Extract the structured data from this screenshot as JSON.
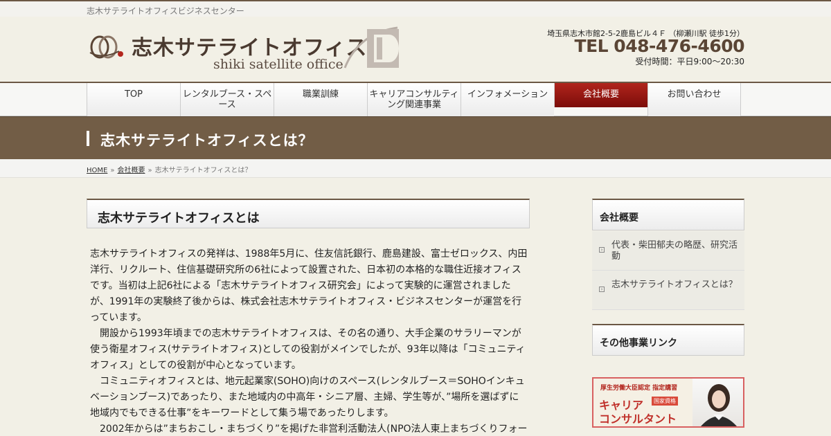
{
  "site": {
    "tagline": "志木サテライトオフィスビジネスセンター",
    "logo_main": "志木サテライトオフィス",
    "logo_sub": "shiki satellite office"
  },
  "contact": {
    "address": "埼玉県志木市館2-5-2鹿島ビル４Ｆ （柳瀬川駅 徒歩1分）",
    "tel": "TEL 048-476-4600",
    "hours": "受付時間：平日9:00～20:30"
  },
  "nav": {
    "items": [
      {
        "label": "TOP"
      },
      {
        "label": "レンタルブース・スペース"
      },
      {
        "label": "職業訓練"
      },
      {
        "label": "キャリアコンサルティング関連事業"
      },
      {
        "label": "インフォメーション"
      },
      {
        "label": "会社概要"
      },
      {
        "label": "お問い合わせ"
      }
    ],
    "active": "会社概要"
  },
  "banner": {
    "title": "志木サテライトオフィスとは？"
  },
  "breadcrumb": {
    "home": "HOME",
    "sep": "»",
    "parent": "会社概要",
    "current": "志木サテライトオフィスとは？"
  },
  "main": {
    "heading": "志木サテライトオフィスとは",
    "paragraphs": [
      "志木サテライトオフィスの発祥は、1988年5月に、住友信託銀行、鹿島建設、富士ゼロックス、内田洋行、リクルート、住信基礎研究所の6社によって設置された、日本初の本格的な職住近接オフィスです。当初は上記6社による「志木サテライトオフィス研究会」によって実験的に運営されましたが、1991年の実験終了後からは、株式会社志木サテライトオフィス・ビジネスセンターが運営を行っています。",
      "　開設から1993年頃までの志木サテライトオフィスは、その名の通り、大手企業のサラリーマンが使う衛星オフィス(サテライトオフィス)としての役割がメインでしたが、93年以降は「コミュニティオフィス」としての役割が中心となっています。",
      "　コミュニティオフィスとは、地元起業家(SOHO)向けのスペース(レンタルブース＝SOHOインキュベーションブース)であったり、また地域内の中高年・シニア層、主婦、学生等が、”場所を選ばずに地域内でもできる仕事”をキーワードとして集う場であったりします。",
      "　2002年からは”まちおこし・まちづくり”を掲げた非営利活動法人(NPO法人東上まちづくりフォー"
    ]
  },
  "sidebar": {
    "section1_title": "会社概要",
    "links": [
      {
        "label": "代表・柴田郁夫の略歴、研究活動"
      },
      {
        "label": "志木サテライトオフィスとは？"
      }
    ],
    "section2_title": "その他事業リンク",
    "ad": {
      "small": "厚生労働大臣認定 指定講習",
      "badge": "国家資格",
      "line1": "キャリア",
      "line2": "コンサルタント"
    }
  },
  "colors": {
    "brand_brown": "#725d46",
    "active_red": "#9a1812",
    "tel_brown": "#5a4535"
  }
}
